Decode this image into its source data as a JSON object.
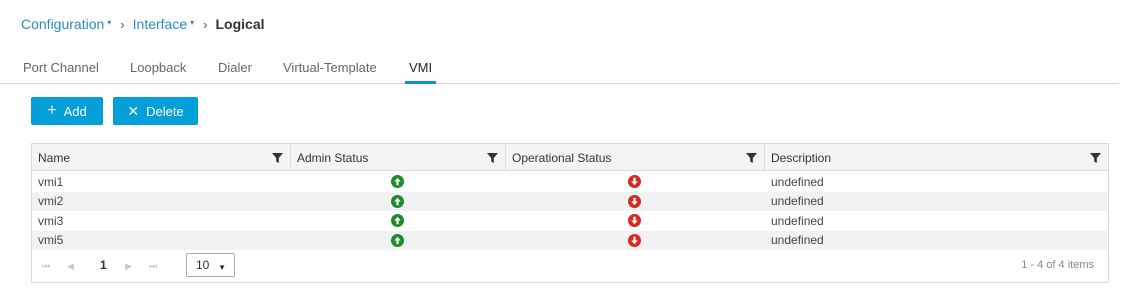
{
  "breadcrumb": {
    "items": [
      {
        "label": "Configuration"
      },
      {
        "label": "Interface"
      }
    ],
    "current": "Logical",
    "caret": "▾",
    "separator": "›"
  },
  "tabs": [
    {
      "label": "Port Channel",
      "active": false
    },
    {
      "label": "Loopback",
      "active": false
    },
    {
      "label": "Dialer",
      "active": false
    },
    {
      "label": "Virtual-Template",
      "active": false
    },
    {
      "label": "VMI",
      "active": true
    }
  ],
  "toolbar": {
    "add_label": "Add",
    "add_icon": "+",
    "delete_label": "Delete",
    "delete_icon": "✕"
  },
  "table": {
    "columns": [
      "Name",
      "Admin Status",
      "Operational Status",
      "Description"
    ],
    "rows": [
      {
        "name": "vmi1",
        "admin_status": "up",
        "operational_status": "down",
        "description": "undefined"
      },
      {
        "name": "vmi2",
        "admin_status": "up",
        "operational_status": "down",
        "description": "undefined"
      },
      {
        "name": "vmi3",
        "admin_status": "up",
        "operational_status": "down",
        "description": "undefined"
      },
      {
        "name": "vmi5",
        "admin_status": "up",
        "operational_status": "down",
        "description": "undefined"
      }
    ]
  },
  "pager": {
    "first": "⏮",
    "prev": "◀",
    "current_page": "1",
    "next": "▶",
    "last": "⏭",
    "page_size": "10",
    "dropdown": "▼",
    "info": "1 - 4 of 4 items"
  },
  "colors": {
    "accent": "#049fd9",
    "link": "#2a8bc2",
    "status_up": "#1e8a2c",
    "status_down": "#d42a22"
  }
}
